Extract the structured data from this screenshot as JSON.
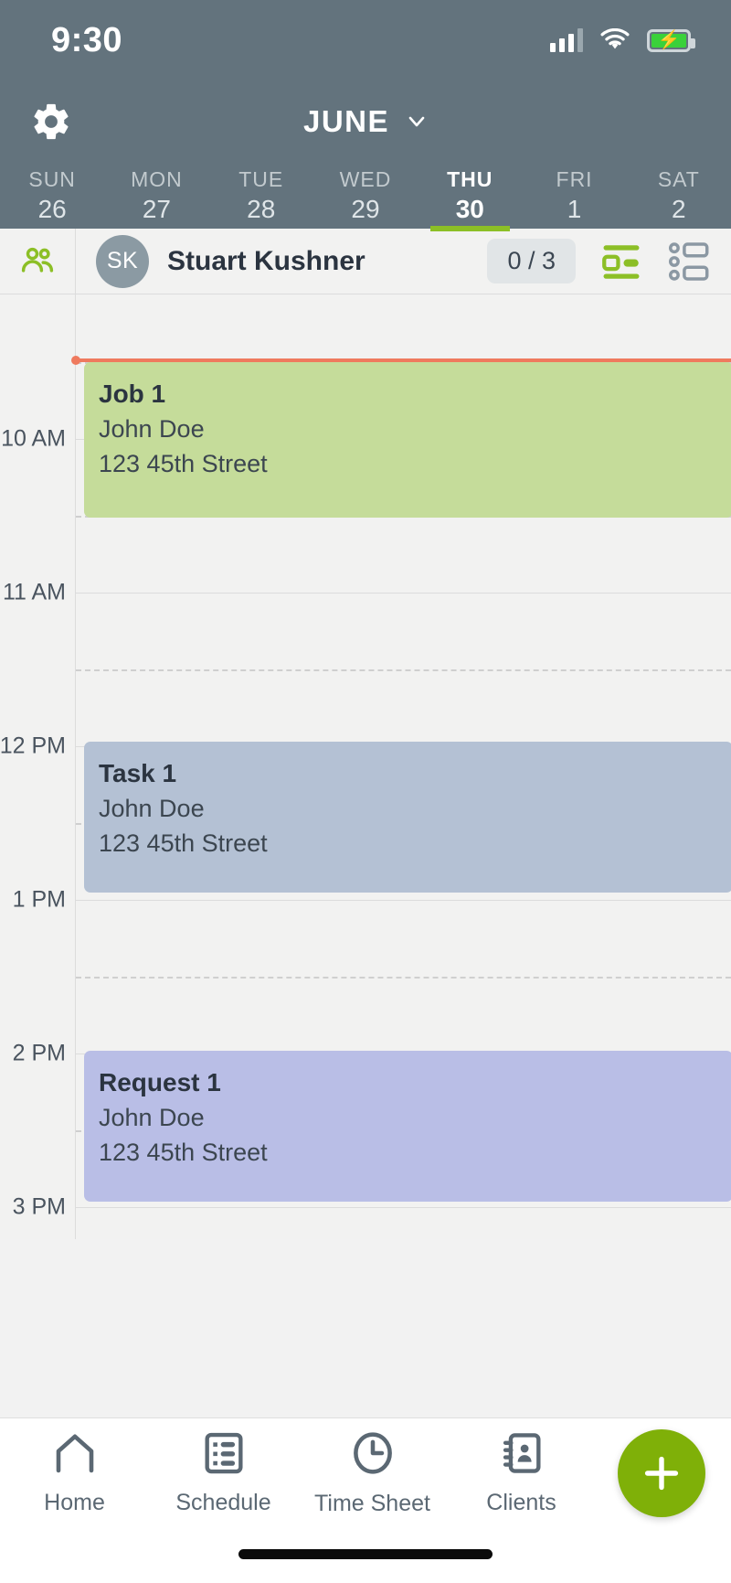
{
  "status_bar": {
    "time": "9:30",
    "cellular_icon": "cellular-bars-icon",
    "wifi_icon": "wifi-icon",
    "battery_icon": "battery-charging-icon",
    "battery_color": "#3ad13a"
  },
  "header": {
    "settings_icon": "gear-icon",
    "month": "JUNE",
    "chevron_icon": "chevron-down-icon",
    "background": "#63737d",
    "accent": "#8cbf26"
  },
  "week": {
    "days": [
      {
        "dow": "SUN",
        "num": "26",
        "active": false
      },
      {
        "dow": "MON",
        "num": "27",
        "active": false
      },
      {
        "dow": "TUE",
        "num": "28",
        "active": false
      },
      {
        "dow": "WED",
        "num": "29",
        "active": false
      },
      {
        "dow": "THU",
        "num": "30",
        "active": true
      },
      {
        "dow": "FRI",
        "num": "1",
        "active": false
      },
      {
        "dow": "SAT",
        "num": "2",
        "active": false
      }
    ]
  },
  "user_row": {
    "people_icon": "people-icon",
    "avatar_initials": "SK",
    "name": "Stuart Kushner",
    "count": "0 / 3",
    "view_day_icon": "day-view-icon",
    "view_list_icon": "list-view-icon"
  },
  "calendar": {
    "hours": [
      "10 AM",
      "11 AM",
      "12 PM",
      "1 PM",
      "2 PM",
      "3 PM"
    ],
    "events": [
      {
        "title": "Job 1",
        "client": "John Doe",
        "address": "123 45th Street",
        "color": "#c5dc9a",
        "type": "job"
      },
      {
        "title": "Task 1",
        "client": "John Doe",
        "address": "123 45th Street",
        "color": "#b4c1d4",
        "type": "task"
      },
      {
        "title": "Request 1",
        "client": "John Doe",
        "address": "123 45th Street",
        "color": "#b9bee6",
        "type": "request"
      }
    ],
    "current_time_color": "#ef7a5e"
  },
  "tabbar": {
    "items": [
      {
        "label": "Home",
        "icon": "home-icon"
      },
      {
        "label": "Schedule",
        "icon": "list-icon"
      },
      {
        "label": "Time Sheet",
        "icon": "clock-icon"
      },
      {
        "label": "Clients",
        "icon": "address-book-icon"
      }
    ],
    "fab_icon": "plus-icon",
    "fab_color": "#7fb008"
  }
}
